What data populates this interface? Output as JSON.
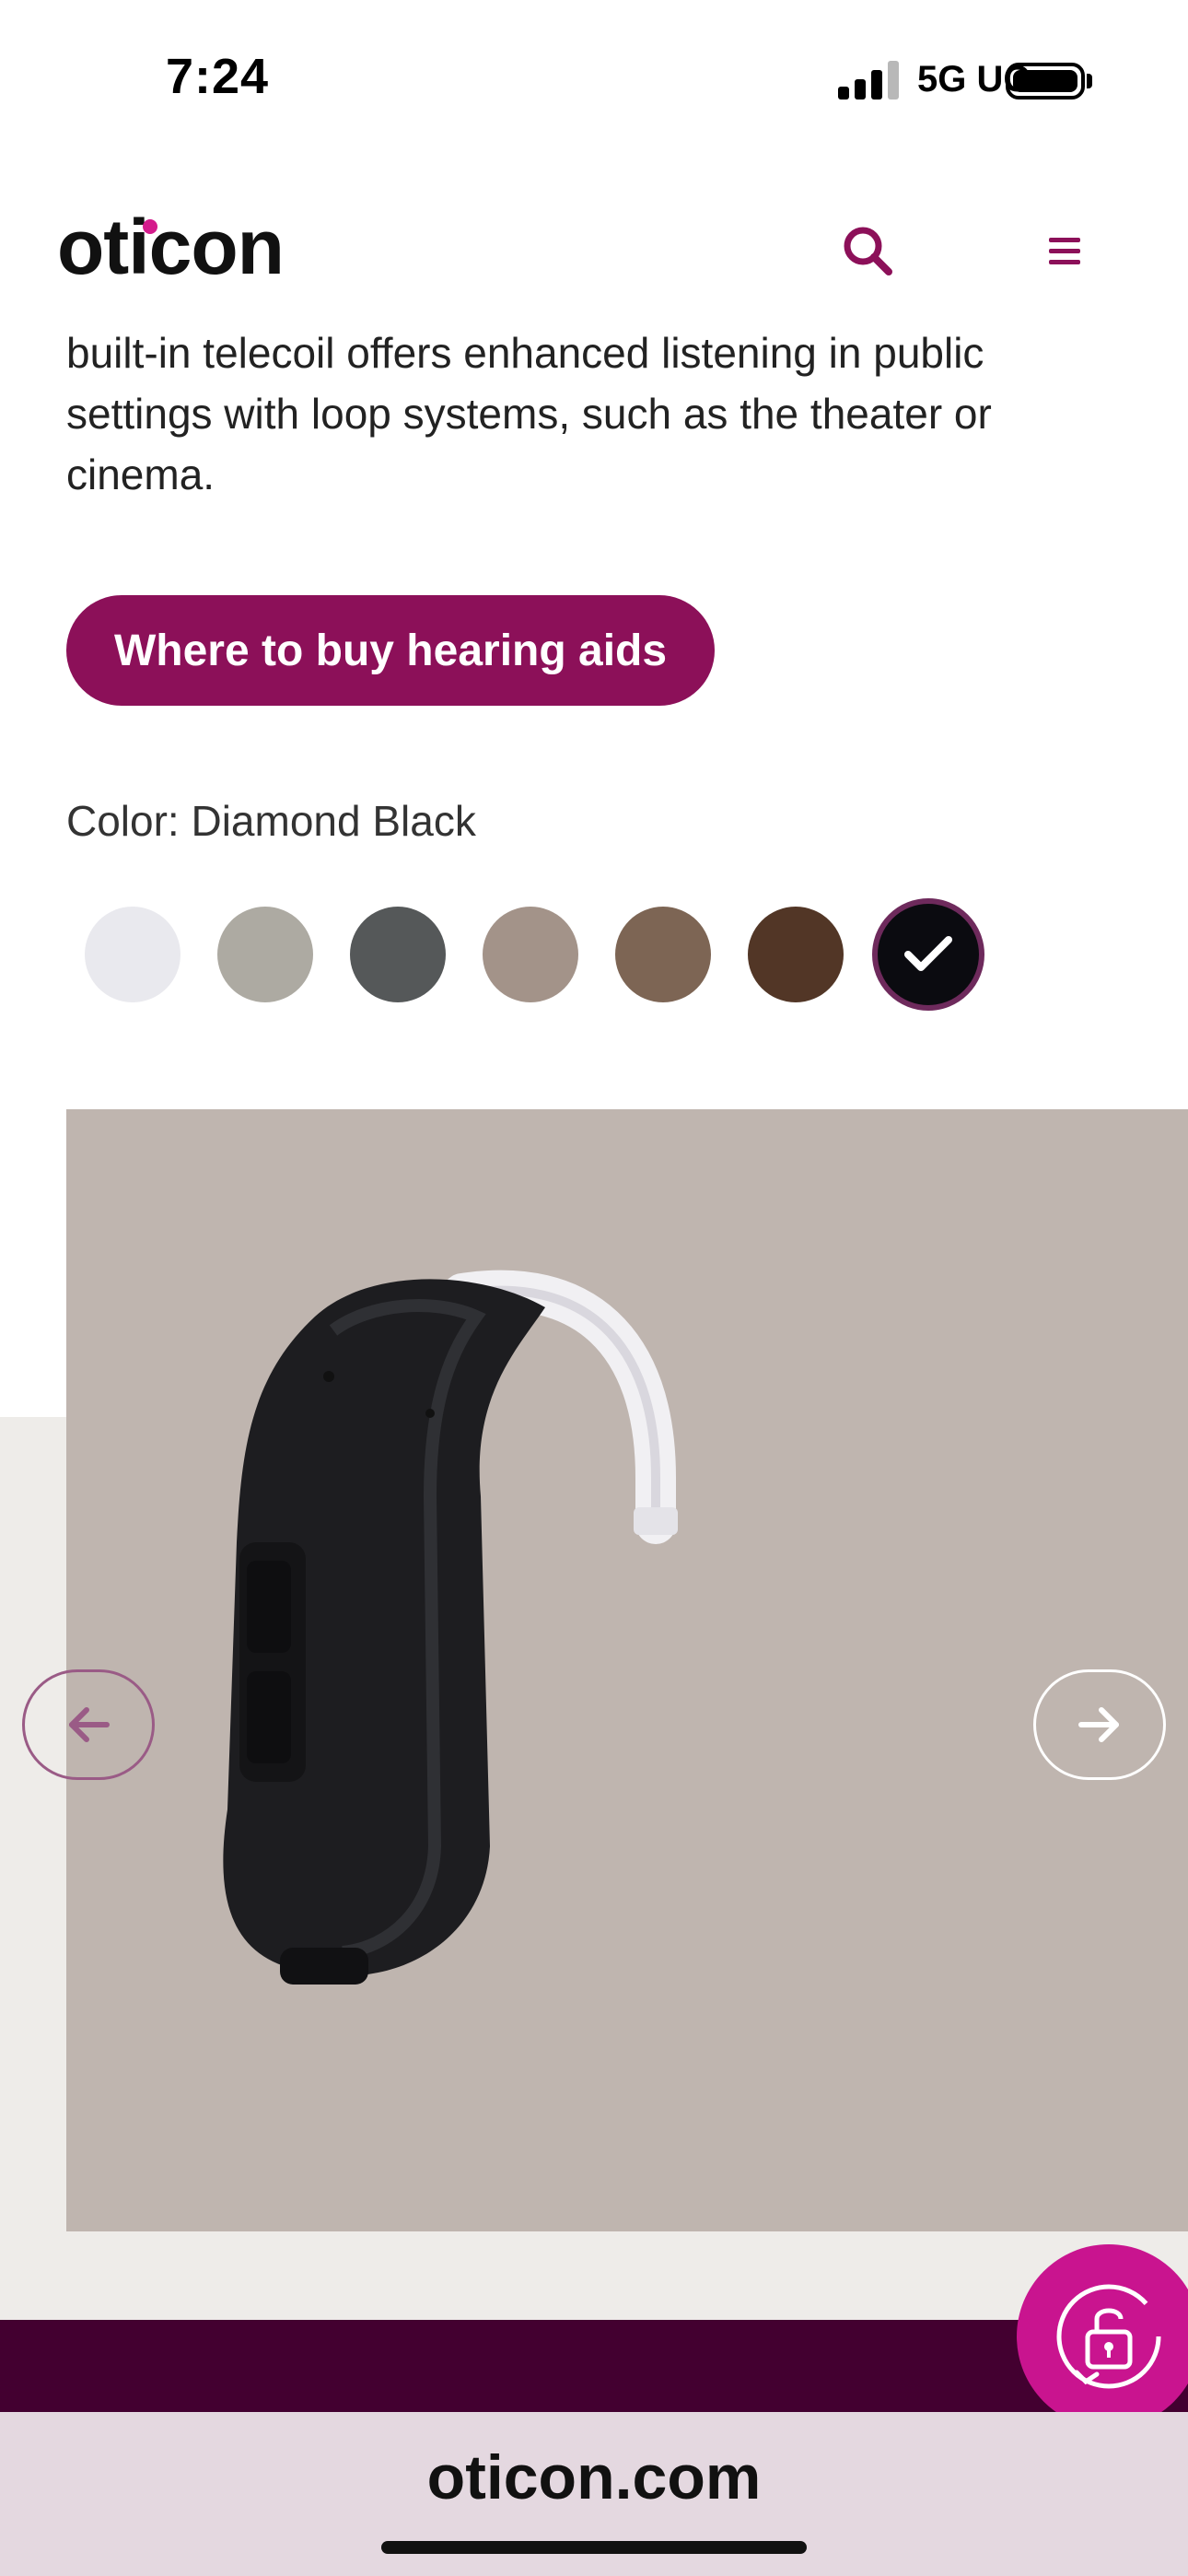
{
  "status_bar": {
    "time": "7:24",
    "network": "5G UC",
    "battery_icon": "battery-icon",
    "signal_icon": "signal-icon"
  },
  "header": {
    "logo": "oticon",
    "search_icon": "search-icon",
    "menu_icon": "hamburger-menu-icon"
  },
  "intro_text": "built-in telecoil offers enhanced listening in public settings with loop systems, such as the theater or cinema.",
  "cta_label": "Where to buy hearing aids",
  "color": {
    "label": "Color: Diamond Black"
  },
  "swatches": [
    {
      "color": "#e9e9ee"
    },
    {
      "color": "#adaaa2"
    },
    {
      "color": "#555859"
    },
    {
      "color": "#a39389"
    },
    {
      "color": "#7d6554"
    },
    {
      "color": "#523626"
    },
    {
      "color": "#0b0b10",
      "selected": true
    }
  ],
  "product": {
    "image_icon": "hearing-aid-image",
    "prev_icon": "arrow-left-icon",
    "next_icon": "arrow-right-icon"
  },
  "accessibility_icon": "accessibility-unlock-icon",
  "browser": {
    "url": "oticon.com"
  },
  "colors": {
    "brand": "#8c1059",
    "footer": "#430030",
    "fab": "#c9148f",
    "stage": "#bfb5af"
  }
}
